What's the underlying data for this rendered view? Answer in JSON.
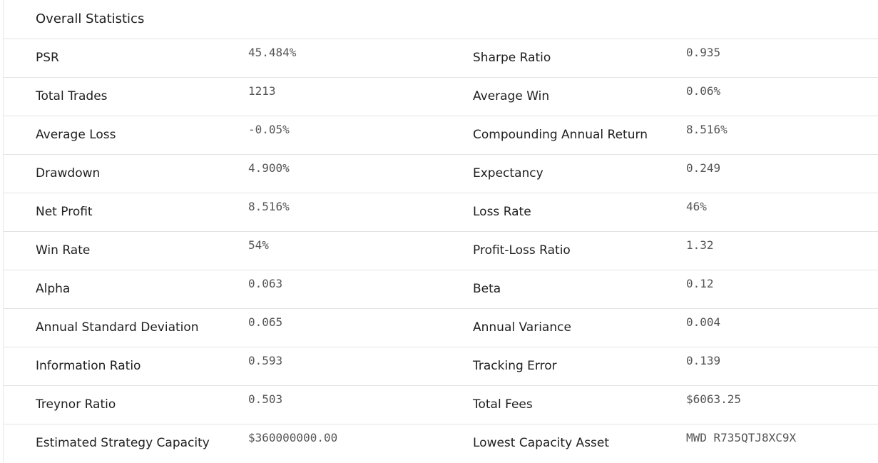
{
  "title": "Overall Statistics",
  "rows": [
    {
      "label1": "PSR",
      "value1": "45.484%",
      "label2": "Sharpe Ratio",
      "value2": "0.935"
    },
    {
      "label1": "Total Trades",
      "value1": "1213",
      "label2": "Average Win",
      "value2": "0.06%"
    },
    {
      "label1": "Average Loss",
      "value1": "-0.05%",
      "label2": "Compounding Annual Return",
      "value2": "8.516%"
    },
    {
      "label1": "Drawdown",
      "value1": "4.900%",
      "label2": "Expectancy",
      "value2": "0.249"
    },
    {
      "label1": "Net Profit",
      "value1": "8.516%",
      "label2": "Loss Rate",
      "value2": "46%"
    },
    {
      "label1": "Win Rate",
      "value1": "54%",
      "label2": "Profit-Loss Ratio",
      "value2": "1.32"
    },
    {
      "label1": "Alpha",
      "value1": "0.063",
      "label2": "Beta",
      "value2": "0.12"
    },
    {
      "label1": "Annual Standard Deviation",
      "value1": "0.065",
      "label2": "Annual Variance",
      "value2": "0.004"
    },
    {
      "label1": "Information Ratio",
      "value1": "0.593",
      "label2": "Tracking Error",
      "value2": "0.139"
    },
    {
      "label1": "Treynor Ratio",
      "value1": "0.503",
      "label2": "Total Fees",
      "value2": "$6063.25"
    },
    {
      "label1": "Estimated Strategy Capacity",
      "value1": "$360000000.00",
      "label2": "Lowest Capacity Asset",
      "value2": "MWD R735QTJ8XC9X"
    }
  ]
}
